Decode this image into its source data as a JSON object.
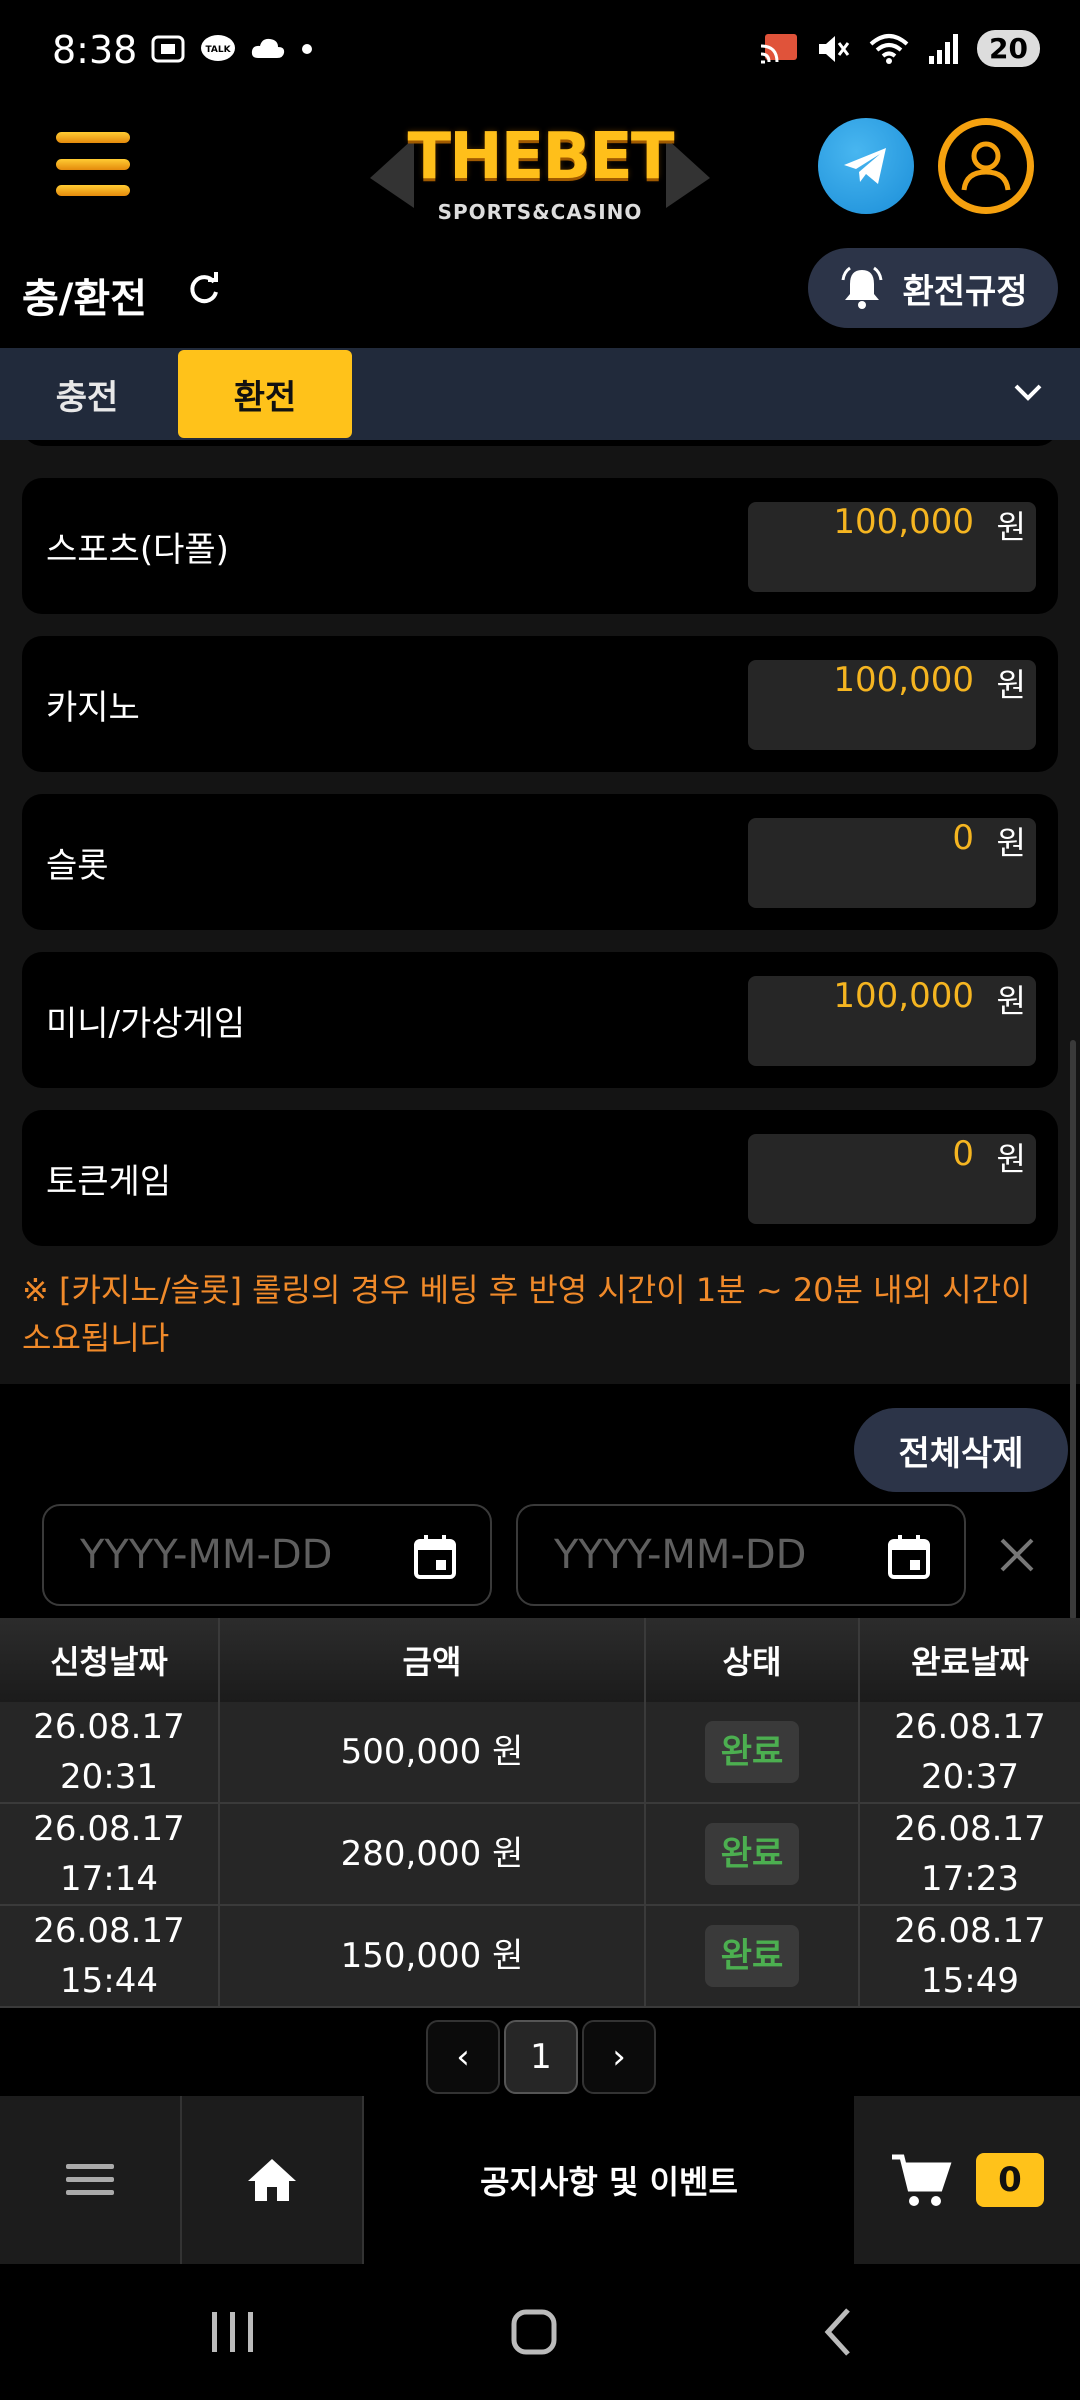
{
  "status_bar": {
    "time": "8:38",
    "battery": "20",
    "icons": [
      "screenshot-icon",
      "talk-icon",
      "cloud-icon",
      "dot-icon",
      "cast-icon",
      "mute-icon",
      "wifi-icon",
      "signal-icon"
    ]
  },
  "header": {
    "logo_title": "THEBET",
    "logo_subtitle": "SPORTS&CASINO",
    "accent": "#ffc21a"
  },
  "page": {
    "title": "충/환전",
    "rules_button": "환전규정"
  },
  "tabs": [
    {
      "label": "충전",
      "active": false
    },
    {
      "label": "환전",
      "active": true
    }
  ],
  "rolling": {
    "items": [
      {
        "label": "스포츠(다폴)",
        "value": "100,000",
        "unit": "원"
      },
      {
        "label": "카지노",
        "value": "100,000",
        "unit": "원"
      },
      {
        "label": "슬롯",
        "value": "0",
        "unit": "원"
      },
      {
        "label": "미니/가상게임",
        "value": "100,000",
        "unit": "원"
      },
      {
        "label": "토큰게임",
        "value": "0",
        "unit": "원"
      }
    ],
    "notice": "※ [카지노/슬롯] 롤링의 경우 베팅 후 반영 시간이 1분 ~ 20분 내외 시간이 소요됩니다"
  },
  "history": {
    "clear_all": "전체삭제",
    "date_from_placeholder": "YYYY-MM-DD",
    "date_to_placeholder": "YYYY-MM-DD",
    "columns": [
      "신청날짜",
      "금액",
      "상태",
      "완료날짜"
    ],
    "rows": [
      {
        "req_date": "26.08.17",
        "req_time": "20:31",
        "amount": "500,000 원",
        "status": "완료",
        "done_date": "26.08.17",
        "done_time": "20:37"
      },
      {
        "req_date": "26.08.17",
        "req_time": "17:14",
        "amount": "280,000 원",
        "status": "완료",
        "done_date": "26.08.17",
        "done_time": "17:23"
      },
      {
        "req_date": "26.08.17",
        "req_time": "15:44",
        "amount": "150,000 원",
        "status": "완료",
        "done_date": "26.08.17",
        "done_time": "15:49"
      }
    ],
    "pager": {
      "prev": "‹",
      "current": "1",
      "next": "›"
    }
  },
  "bottom_nav": {
    "notice_label": "공지사항 및 이벤트",
    "cart_count": "0"
  }
}
